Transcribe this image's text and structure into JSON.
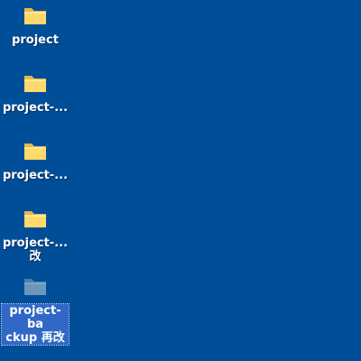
{
  "desktop": {
    "background_color": "#004e98",
    "icons": [
      {
        "label": "project",
        "icon": "folder-icon",
        "selected": false
      },
      {
        "label": "project-...",
        "icon": "folder-icon",
        "selected": false
      },
      {
        "label": "project-...",
        "icon": "folder-icon",
        "selected": false
      },
      {
        "label": "project-...\n改",
        "icon": "folder-icon",
        "selected": false
      },
      {
        "label": "project-ba\nckup 再改",
        "icon": "folder-icon",
        "selected": true
      }
    ]
  }
}
